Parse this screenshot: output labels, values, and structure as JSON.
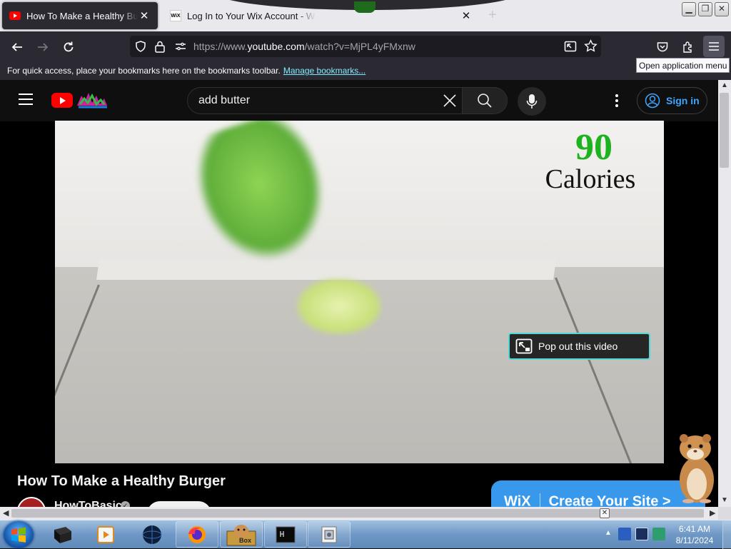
{
  "browser": {
    "tabs": [
      {
        "title": "How To Make a Healthy Burger",
        "close": "✕",
        "favicon": "youtube-favicon"
      },
      {
        "title": "Log In to Your Wix Account - Wix",
        "close": "✕",
        "favicon": "wix-favicon",
        "favicon_text": "WiX"
      }
    ],
    "new_tab": "+",
    "url_prefix": "https://www.",
    "url_domain": "youtube.com",
    "url_rest": "/watch?v=MjPL4yFMxnw",
    "bookmarks_message": "For quick access, place your bookmarks here on the bookmarks toolbar.",
    "manage_bookmarks": "Manage bookmarks...",
    "app_menu_tooltip": "Open application menu"
  },
  "youtube": {
    "search_value": "add butter",
    "sign_in": "Sign in",
    "video": {
      "calories_number": "90",
      "calories_label": "Calories",
      "popout": "Pop out this video"
    },
    "video_title": "How To Make a Healthy Burger",
    "channel_name": "HowToBasic",
    "verified": "✓"
  },
  "wix_banner": {
    "logo": "WiX",
    "cta": "Create Your Site >"
  },
  "taskbar": {
    "time": "6:41 AM",
    "date": "8/11/2024",
    "task_labels": {
      "box": "Box"
    }
  },
  "colors": {
    "youtube_red": "#ff0000",
    "link_blue": "#3ea6ff",
    "calorie_green": "#1fb21f",
    "popout_border": "#55d6d6",
    "wix_blue": "#3899ec"
  }
}
